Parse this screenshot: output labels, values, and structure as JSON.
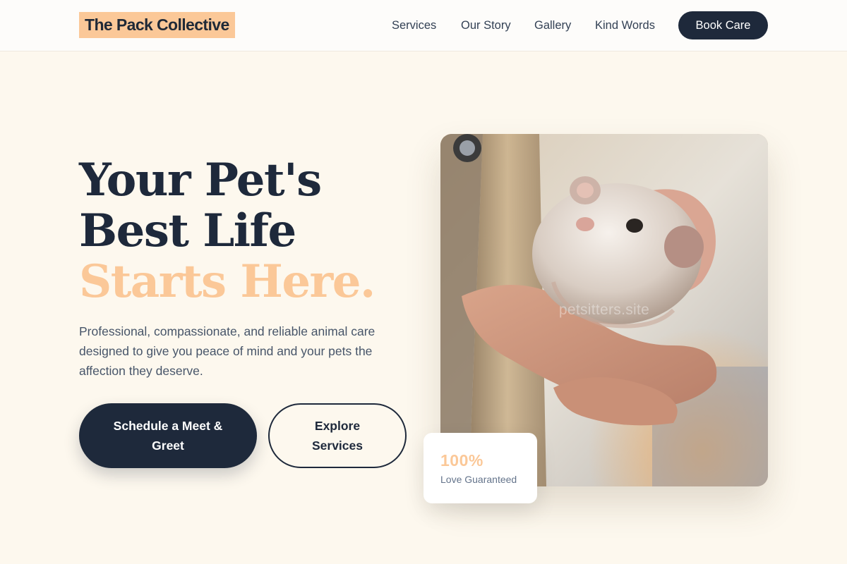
{
  "nav": {
    "brand": "The Pack Collective",
    "links": [
      "Services",
      "Our Story",
      "Gallery",
      "Kind Words"
    ],
    "cta": "Book Care"
  },
  "hero": {
    "headline_lines": [
      "Your Pet's",
      "Best Life"
    ],
    "headline_accent": "Starts Here.",
    "subtitle": "Professional, compassionate, and reliable animal care designed to give you peace of mind and your pets the affection they deserve.",
    "primary_cta": "Schedule a Meet & Greet",
    "secondary_cta": "Explore Services",
    "image_watermark": "petsitters.site",
    "stat": {
      "value": "100%",
      "label": "Love Guaranteed"
    }
  },
  "colors": {
    "accent": "#fbc898",
    "navy": "#1e293b",
    "background": "#fdf8ee"
  },
  "icons": {
    "photo": "hamster-in-hand-photo"
  }
}
